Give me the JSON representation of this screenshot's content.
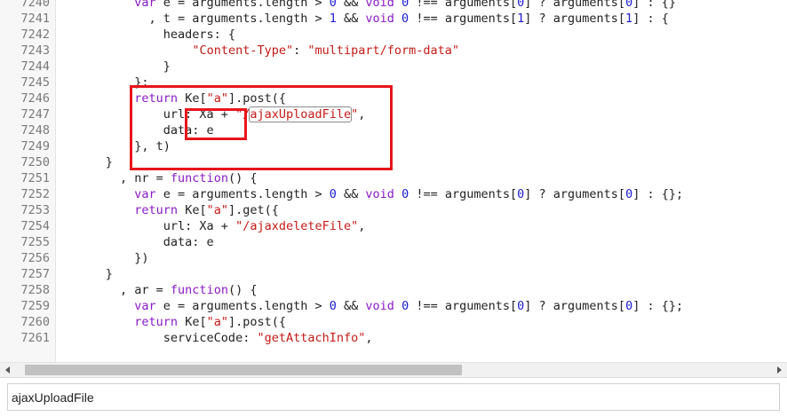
{
  "editor": {
    "lines": [
      {
        "num": "7240",
        "tokens": [
          {
            "t": "          ",
            "c": "plain"
          },
          {
            "t": "var",
            "c": "kw"
          },
          {
            "t": " e = arguments.length > ",
            "c": "plain"
          },
          {
            "t": "0",
            "c": "num"
          },
          {
            "t": " && ",
            "c": "plain"
          },
          {
            "t": "void",
            "c": "kw"
          },
          {
            "t": " ",
            "c": "plain"
          },
          {
            "t": "0",
            "c": "num"
          },
          {
            "t": " !== arguments[",
            "c": "plain"
          },
          {
            "t": "0",
            "c": "num"
          },
          {
            "t": "] ? arguments[",
            "c": "plain"
          },
          {
            "t": "0",
            "c": "num"
          },
          {
            "t": "] : {}",
            "c": "plain"
          }
        ]
      },
      {
        "num": "7241",
        "tokens": [
          {
            "t": "            , t = arguments.length > ",
            "c": "plain"
          },
          {
            "t": "1",
            "c": "num"
          },
          {
            "t": " && ",
            "c": "plain"
          },
          {
            "t": "void",
            "c": "kw"
          },
          {
            "t": " ",
            "c": "plain"
          },
          {
            "t": "0",
            "c": "num"
          },
          {
            "t": " !== arguments[",
            "c": "plain"
          },
          {
            "t": "1",
            "c": "num"
          },
          {
            "t": "] ? arguments[",
            "c": "plain"
          },
          {
            "t": "1",
            "c": "num"
          },
          {
            "t": "] : {",
            "c": "plain"
          }
        ]
      },
      {
        "num": "7242",
        "tokens": [
          {
            "t": "              headers: {",
            "c": "plain"
          }
        ]
      },
      {
        "num": "7243",
        "tokens": [
          {
            "t": "                  ",
            "c": "plain"
          },
          {
            "t": "\"Content-Type\"",
            "c": "str"
          },
          {
            "t": ": ",
            "c": "plain"
          },
          {
            "t": "\"multipart/form-data\"",
            "c": "str"
          }
        ]
      },
      {
        "num": "7244",
        "tokens": [
          {
            "t": "              }",
            "c": "plain"
          }
        ]
      },
      {
        "num": "7245",
        "tokens": [
          {
            "t": "          };",
            "c": "plain"
          }
        ]
      },
      {
        "num": "7246",
        "tokens": [
          {
            "t": "          ",
            "c": "plain"
          },
          {
            "t": "return",
            "c": "kw"
          },
          {
            "t": " Ke[",
            "c": "plain"
          },
          {
            "t": "\"a\"",
            "c": "str"
          },
          {
            "t": "].post({",
            "c": "plain"
          }
        ]
      },
      {
        "num": "7247",
        "tokens": [
          {
            "t": "              url: Xa + ",
            "c": "plain"
          },
          {
            "t": "\"/",
            "c": "str"
          },
          {
            "t": "ajaxUploadFile",
            "c": "str",
            "hit": true
          },
          {
            "t": "\"",
            "c": "str"
          },
          {
            "t": ",",
            "c": "plain"
          }
        ]
      },
      {
        "num": "7248",
        "tokens": [
          {
            "t": "              data: e",
            "c": "plain"
          }
        ]
      },
      {
        "num": "7249",
        "tokens": [
          {
            "t": "          }, t)",
            "c": "plain"
          }
        ]
      },
      {
        "num": "7250",
        "tokens": [
          {
            "t": "      }",
            "c": "plain"
          }
        ]
      },
      {
        "num": "7251",
        "tokens": [
          {
            "t": "        , nr = ",
            "c": "plain"
          },
          {
            "t": "function",
            "c": "kw"
          },
          {
            "t": "() {",
            "c": "plain"
          }
        ]
      },
      {
        "num": "7252",
        "tokens": [
          {
            "t": "          ",
            "c": "plain"
          },
          {
            "t": "var",
            "c": "kw"
          },
          {
            "t": " e = arguments.length > ",
            "c": "plain"
          },
          {
            "t": "0",
            "c": "num"
          },
          {
            "t": " && ",
            "c": "plain"
          },
          {
            "t": "void",
            "c": "kw"
          },
          {
            "t": " ",
            "c": "plain"
          },
          {
            "t": "0",
            "c": "num"
          },
          {
            "t": " !== arguments[",
            "c": "plain"
          },
          {
            "t": "0",
            "c": "num"
          },
          {
            "t": "] ? arguments[",
            "c": "plain"
          },
          {
            "t": "0",
            "c": "num"
          },
          {
            "t": "] : {};",
            "c": "plain"
          }
        ]
      },
      {
        "num": "7253",
        "tokens": [
          {
            "t": "          ",
            "c": "plain"
          },
          {
            "t": "return",
            "c": "kw"
          },
          {
            "t": " Ke[",
            "c": "plain"
          },
          {
            "t": "\"a\"",
            "c": "str"
          },
          {
            "t": "].get({",
            "c": "plain"
          }
        ]
      },
      {
        "num": "7254",
        "tokens": [
          {
            "t": "              url: Xa + ",
            "c": "plain"
          },
          {
            "t": "\"/ajaxdeleteFile\"",
            "c": "str"
          },
          {
            "t": ",",
            "c": "plain"
          }
        ]
      },
      {
        "num": "7255",
        "tokens": [
          {
            "t": "              data: e",
            "c": "plain"
          }
        ]
      },
      {
        "num": "7256",
        "tokens": [
          {
            "t": "          })",
            "c": "plain"
          }
        ]
      },
      {
        "num": "7257",
        "tokens": [
          {
            "t": "      }",
            "c": "plain"
          }
        ]
      },
      {
        "num": "7258",
        "tokens": [
          {
            "t": "        , ar = ",
            "c": "plain"
          },
          {
            "t": "function",
            "c": "kw"
          },
          {
            "t": "() {",
            "c": "plain"
          }
        ]
      },
      {
        "num": "7259",
        "tokens": [
          {
            "t": "          ",
            "c": "plain"
          },
          {
            "t": "var",
            "c": "kw"
          },
          {
            "t": " e = arguments.length > ",
            "c": "plain"
          },
          {
            "t": "0",
            "c": "num"
          },
          {
            "t": " && ",
            "c": "plain"
          },
          {
            "t": "void",
            "c": "kw"
          },
          {
            "t": " ",
            "c": "plain"
          },
          {
            "t": "0",
            "c": "num"
          },
          {
            "t": " !== arguments[",
            "c": "plain"
          },
          {
            "t": "0",
            "c": "num"
          },
          {
            "t": "] ? arguments[",
            "c": "plain"
          },
          {
            "t": "0",
            "c": "num"
          },
          {
            "t": "] : {};",
            "c": "plain"
          }
        ]
      },
      {
        "num": "7260",
        "tokens": [
          {
            "t": "          ",
            "c": "plain"
          },
          {
            "t": "return",
            "c": "kw"
          },
          {
            "t": " Ke[",
            "c": "plain"
          },
          {
            "t": "\"a\"",
            "c": "str"
          },
          {
            "t": "].post({",
            "c": "plain"
          }
        ]
      },
      {
        "num": "7261",
        "tokens": [
          {
            "t": "              serviceCode: ",
            "c": "plain"
          },
          {
            "t": "\"getAttachInfo\"",
            "c": "str"
          },
          {
            "t": ",",
            "c": "plain"
          }
        ]
      }
    ]
  },
  "find": {
    "query": "ajaxUploadFile"
  },
  "colors": {
    "keyword": "#8a1bc5",
    "number": "#1b1bd3",
    "string": "#c41a16",
    "annotation": "#e8141b"
  }
}
